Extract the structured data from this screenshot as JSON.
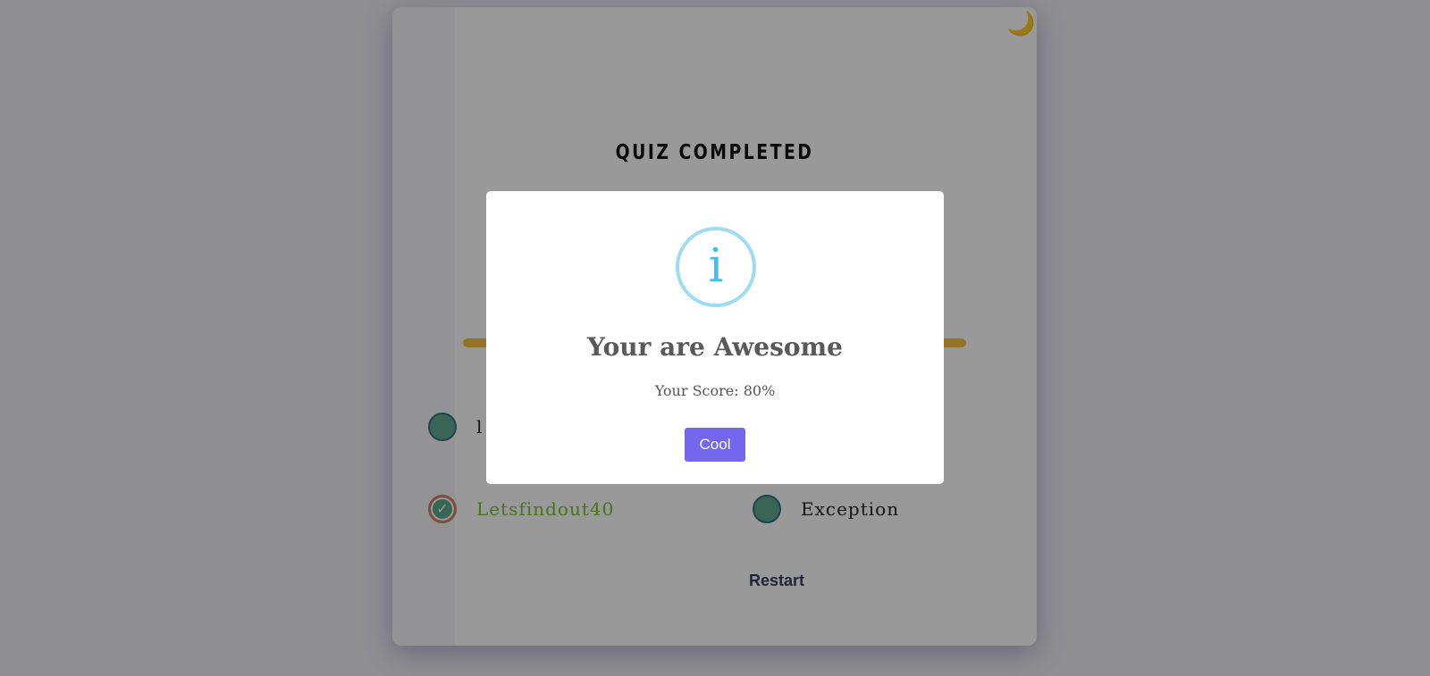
{
  "quiz": {
    "title": "QUIZ COMPLETED",
    "theme_toggle_icon": "moon-icon",
    "theme_toggle_glyph": "🌙",
    "progress_color": "#f5bf3c",
    "options": [
      {
        "label": "l",
        "state": "default"
      },
      {
        "label": "Letsfindout40",
        "state": "correct"
      },
      {
        "label": "Exception",
        "state": "default"
      }
    ],
    "restart_label": "Restart"
  },
  "modal": {
    "icon": "info-icon",
    "icon_glyph": "i",
    "title": "Your are Awesome",
    "score_text": "Your Score: 80%",
    "confirm_label": "Cool",
    "accent_color": "#7367f0"
  }
}
